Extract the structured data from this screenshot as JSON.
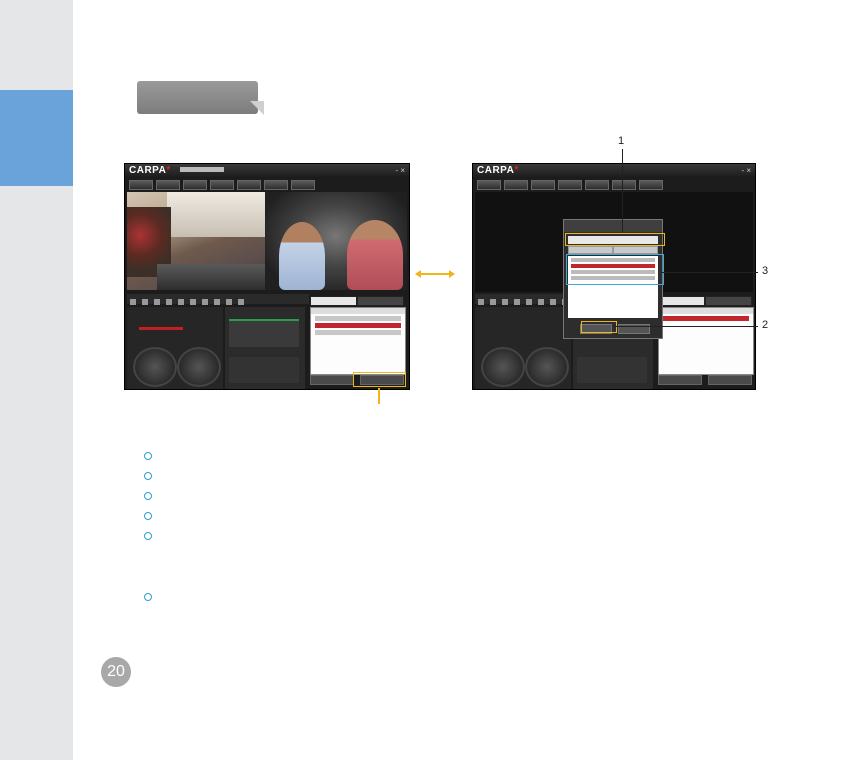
{
  "callouts": [
    "1",
    "2",
    "3"
  ],
  "page_number": "20",
  "screenshot_left": {
    "logo": "CARPA",
    "window_controls": "- ×"
  },
  "screenshot_right": {
    "logo": "CARPA",
    "window_controls": "- ×"
  },
  "colors": {
    "side_tab": "#6aa3da",
    "highlight_yellow": "#f1b51c",
    "highlight_blue": "#3fa8d8",
    "bullet": "#2a9fd6",
    "brand_red": "#d8232a"
  },
  "bullet_count": 6
}
